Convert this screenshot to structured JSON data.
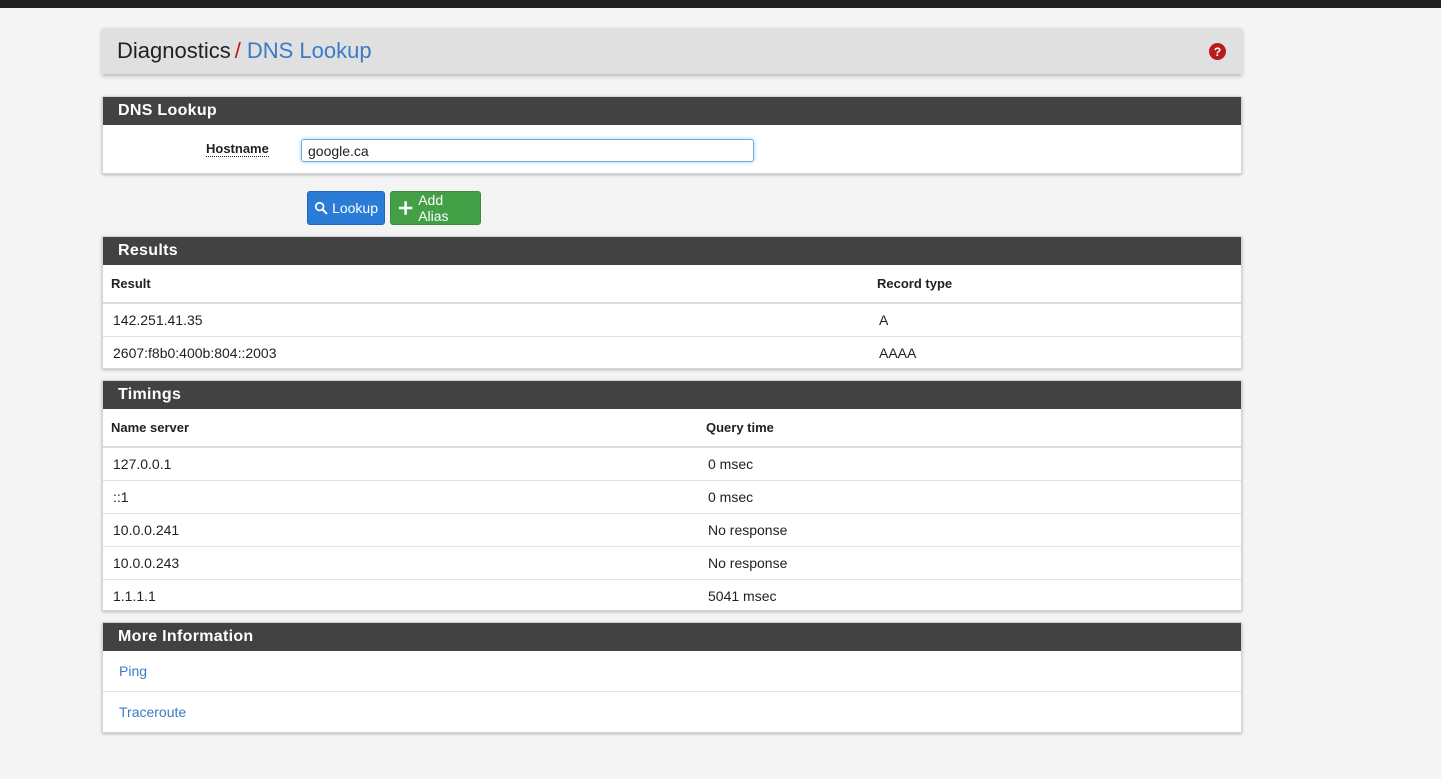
{
  "breadcrumb": {
    "root": "Diagnostics",
    "separator": "/",
    "current": "DNS Lookup"
  },
  "help_icon": {
    "name": "help-icon",
    "glyph": "?"
  },
  "lookup_panel": {
    "title": "DNS Lookup",
    "hostname_label": "Hostname",
    "hostname_value": "google.ca"
  },
  "buttons": {
    "lookup_label": "Lookup",
    "lookup_icon": "search-icon",
    "add_alias_label": "Add Alias",
    "add_alias_icon": "plus-icon"
  },
  "results": {
    "title": "Results",
    "columns": [
      "Result",
      "Record type"
    ],
    "rows": [
      [
        "142.251.41.35",
        "A"
      ],
      [
        "2607:f8b0:400b:804::2003",
        "AAAA"
      ]
    ]
  },
  "timings": {
    "title": "Timings",
    "columns": [
      "Name server",
      "Query time"
    ],
    "rows": [
      [
        "127.0.0.1",
        "0 msec"
      ],
      [
        "::1",
        "0 msec"
      ],
      [
        "10.0.0.241",
        "No response"
      ],
      [
        "10.0.0.243",
        "No response"
      ],
      [
        "1.1.1.1",
        "5041 msec"
      ]
    ]
  },
  "more_info": {
    "title": "More Information",
    "links": [
      "Ping",
      "Traceroute"
    ]
  },
  "colors": {
    "heading_bg": "#424242",
    "link": "#3a7bc8",
    "accent_red": "#b71c1c",
    "btn_primary": "#2a7cd7",
    "btn_success": "#43a047"
  }
}
